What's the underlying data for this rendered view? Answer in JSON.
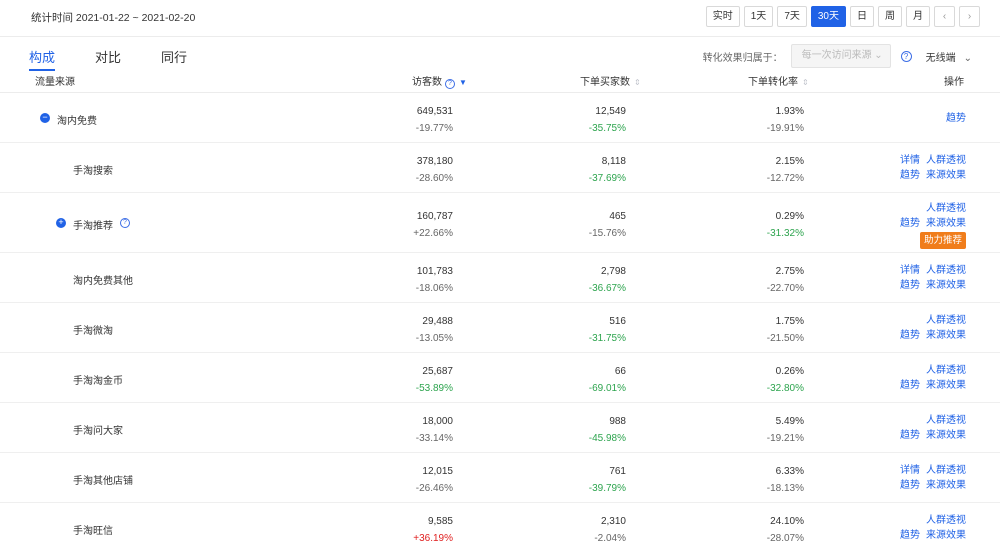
{
  "header": {
    "stat_date": "统计时间 2021-01-22 ~ 2021-02-20",
    "range_buttons": [
      "实时",
      "1天",
      "7天",
      "30天",
      "日",
      "周",
      "月"
    ],
    "active_range": "30天"
  },
  "tabs": [
    "构成",
    "对比",
    "同行"
  ],
  "attribution": {
    "label": "转化效果归属于：",
    "select_value": "每一次访问来源",
    "device": "无线端"
  },
  "table": {
    "headers": [
      "流量来源",
      "访客数",
      "下单买家数",
      "下单转化率",
      "操作"
    ],
    "rows": [
      {
        "name": "淘内免费",
        "expand": "−",
        "visitors": "649,531",
        "visitors_chg": "-19.77%",
        "buyers": "12,549",
        "buyers_chg": "-35.75%",
        "rate": "1.93%",
        "rate_chg": "-19.91%",
        "ops1": [
          "趋势"
        ],
        "ops2": []
      },
      {
        "name": "手淘搜索",
        "visitors": "378,180",
        "visitors_chg": "-28.60%",
        "buyers": "8,118",
        "buyers_chg": "-37.69%",
        "rate": "2.15%",
        "rate_chg": "-12.72%",
        "ops1": [
          "详情",
          "人群透视"
        ],
        "ops2": [
          "趋势",
          "来源效果"
        ]
      },
      {
        "name": "手淘推荐",
        "expand": "+",
        "help": "?",
        "visitors": "160,787",
        "visitors_chg": "+22.66%",
        "buyers": "465",
        "buyers_chg": "-15.76%",
        "rate": "0.29%",
        "rate_chg": "-31.32%",
        "ops1": [
          "人群透视"
        ],
        "ops2": [
          "趋势",
          "来源效果"
        ],
        "badge": "助力推荐"
      },
      {
        "name": "淘内免费其他",
        "visitors": "101,783",
        "visitors_chg": "-18.06%",
        "buyers": "2,798",
        "buyers_chg": "-36.67%",
        "rate": "2.75%",
        "rate_chg": "-22.70%",
        "ops1": [
          "详情",
          "人群透视"
        ],
        "ops2": [
          "趋势",
          "来源效果"
        ]
      },
      {
        "name": "手淘微淘",
        "visitors": "29,488",
        "visitors_chg": "-13.05%",
        "buyers": "516",
        "buyers_chg": "-31.75%",
        "rate": "1.75%",
        "rate_chg": "-21.50%",
        "ops1": [
          "人群透视"
        ],
        "ops2": [
          "趋势",
          "来源效果"
        ]
      },
      {
        "name": "手淘淘金币",
        "visitors": "25,687",
        "visitors_chg": "-53.89%",
        "buyers": "66",
        "buyers_chg": "-69.01%",
        "rate": "0.26%",
        "rate_chg": "-32.80%",
        "ops1": [
          "人群透视"
        ],
        "ops2": [
          "趋势",
          "来源效果"
        ]
      },
      {
        "name": "手淘问大家",
        "visitors": "18,000",
        "visitors_chg": "-33.14%",
        "buyers": "988",
        "buyers_chg": "-45.98%",
        "rate": "5.49%",
        "rate_chg": "-19.21%",
        "ops1": [
          "人群透视"
        ],
        "ops2": [
          "趋势",
          "来源效果"
        ]
      },
      {
        "name": "手淘其他店铺",
        "visitors": "12,015",
        "visitors_chg": "-26.46%",
        "buyers": "761",
        "buyers_chg": "-39.79%",
        "rate": "6.33%",
        "rate_chg": "-18.13%",
        "ops1": [
          "详情",
          "人群透视"
        ],
        "ops2": [
          "趋势",
          "来源效果"
        ]
      },
      {
        "name": "手淘旺信",
        "visitors": "9,585",
        "visitors_chg": "+36.19%",
        "buyers": "2,310",
        "buyers_chg": "-2.04%",
        "rate": "24.10%",
        "rate_chg": "-28.07%",
        "ops1": [
          "人群透视"
        ],
        "ops2": [
          "趋势",
          "来源效果"
        ]
      }
    ],
    "change_colors": {
      "visitors": [
        "gray",
        "gray",
        "gray",
        "gray",
        "gray",
        "green",
        "gray",
        "gray",
        "red"
      ],
      "buyers": [
        "green",
        "green",
        "gray",
        "green",
        "green",
        "green",
        "green",
        "green",
        "gray"
      ],
      "rate": [
        "gray",
        "gray",
        "green",
        "gray",
        "gray",
        "green",
        "gray",
        "gray",
        "gray"
      ]
    }
  },
  "colors": {
    "accent": "#2062e6",
    "up": "#e02020",
    "down": "#2da44e",
    "badge": "#f07d1b"
  }
}
